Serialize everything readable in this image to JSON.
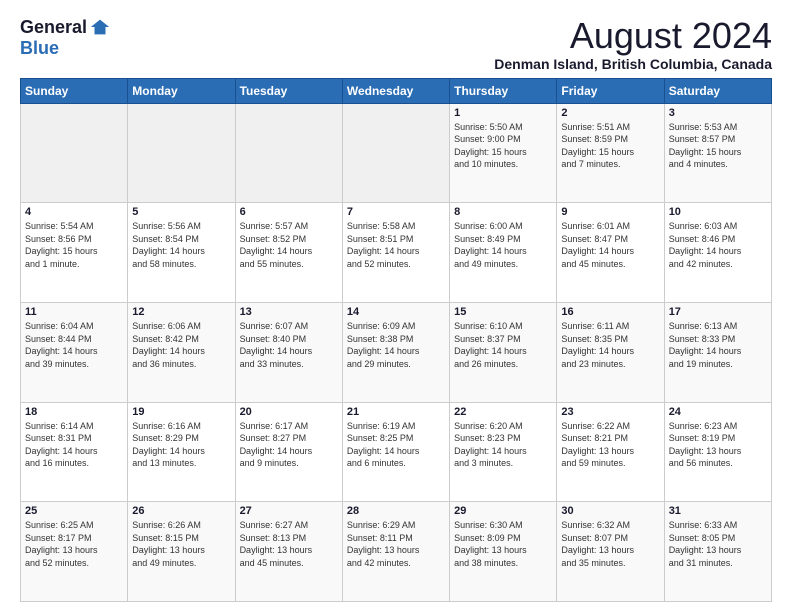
{
  "logo": {
    "general": "General",
    "blue": "Blue"
  },
  "title": "August 2024",
  "subtitle": "Denman Island, British Columbia, Canada",
  "days_of_week": [
    "Sunday",
    "Monday",
    "Tuesday",
    "Wednesday",
    "Thursday",
    "Friday",
    "Saturday"
  ],
  "weeks": [
    [
      {
        "day": "",
        "info": ""
      },
      {
        "day": "",
        "info": ""
      },
      {
        "day": "",
        "info": ""
      },
      {
        "day": "",
        "info": ""
      },
      {
        "day": "1",
        "info": "Sunrise: 5:50 AM\nSunset: 9:00 PM\nDaylight: 15 hours\nand 10 minutes."
      },
      {
        "day": "2",
        "info": "Sunrise: 5:51 AM\nSunset: 8:59 PM\nDaylight: 15 hours\nand 7 minutes."
      },
      {
        "day": "3",
        "info": "Sunrise: 5:53 AM\nSunset: 8:57 PM\nDaylight: 15 hours\nand 4 minutes."
      }
    ],
    [
      {
        "day": "4",
        "info": "Sunrise: 5:54 AM\nSunset: 8:56 PM\nDaylight: 15 hours\nand 1 minute."
      },
      {
        "day": "5",
        "info": "Sunrise: 5:56 AM\nSunset: 8:54 PM\nDaylight: 14 hours\nand 58 minutes."
      },
      {
        "day": "6",
        "info": "Sunrise: 5:57 AM\nSunset: 8:52 PM\nDaylight: 14 hours\nand 55 minutes."
      },
      {
        "day": "7",
        "info": "Sunrise: 5:58 AM\nSunset: 8:51 PM\nDaylight: 14 hours\nand 52 minutes."
      },
      {
        "day": "8",
        "info": "Sunrise: 6:00 AM\nSunset: 8:49 PM\nDaylight: 14 hours\nand 49 minutes."
      },
      {
        "day": "9",
        "info": "Sunrise: 6:01 AM\nSunset: 8:47 PM\nDaylight: 14 hours\nand 45 minutes."
      },
      {
        "day": "10",
        "info": "Sunrise: 6:03 AM\nSunset: 8:46 PM\nDaylight: 14 hours\nand 42 minutes."
      }
    ],
    [
      {
        "day": "11",
        "info": "Sunrise: 6:04 AM\nSunset: 8:44 PM\nDaylight: 14 hours\nand 39 minutes."
      },
      {
        "day": "12",
        "info": "Sunrise: 6:06 AM\nSunset: 8:42 PM\nDaylight: 14 hours\nand 36 minutes."
      },
      {
        "day": "13",
        "info": "Sunrise: 6:07 AM\nSunset: 8:40 PM\nDaylight: 14 hours\nand 33 minutes."
      },
      {
        "day": "14",
        "info": "Sunrise: 6:09 AM\nSunset: 8:38 PM\nDaylight: 14 hours\nand 29 minutes."
      },
      {
        "day": "15",
        "info": "Sunrise: 6:10 AM\nSunset: 8:37 PM\nDaylight: 14 hours\nand 26 minutes."
      },
      {
        "day": "16",
        "info": "Sunrise: 6:11 AM\nSunset: 8:35 PM\nDaylight: 14 hours\nand 23 minutes."
      },
      {
        "day": "17",
        "info": "Sunrise: 6:13 AM\nSunset: 8:33 PM\nDaylight: 14 hours\nand 19 minutes."
      }
    ],
    [
      {
        "day": "18",
        "info": "Sunrise: 6:14 AM\nSunset: 8:31 PM\nDaylight: 14 hours\nand 16 minutes."
      },
      {
        "day": "19",
        "info": "Sunrise: 6:16 AM\nSunset: 8:29 PM\nDaylight: 14 hours\nand 13 minutes."
      },
      {
        "day": "20",
        "info": "Sunrise: 6:17 AM\nSunset: 8:27 PM\nDaylight: 14 hours\nand 9 minutes."
      },
      {
        "day": "21",
        "info": "Sunrise: 6:19 AM\nSunset: 8:25 PM\nDaylight: 14 hours\nand 6 minutes."
      },
      {
        "day": "22",
        "info": "Sunrise: 6:20 AM\nSunset: 8:23 PM\nDaylight: 14 hours\nand 3 minutes."
      },
      {
        "day": "23",
        "info": "Sunrise: 6:22 AM\nSunset: 8:21 PM\nDaylight: 13 hours\nand 59 minutes."
      },
      {
        "day": "24",
        "info": "Sunrise: 6:23 AM\nSunset: 8:19 PM\nDaylight: 13 hours\nand 56 minutes."
      }
    ],
    [
      {
        "day": "25",
        "info": "Sunrise: 6:25 AM\nSunset: 8:17 PM\nDaylight: 13 hours\nand 52 minutes."
      },
      {
        "day": "26",
        "info": "Sunrise: 6:26 AM\nSunset: 8:15 PM\nDaylight: 13 hours\nand 49 minutes."
      },
      {
        "day": "27",
        "info": "Sunrise: 6:27 AM\nSunset: 8:13 PM\nDaylight: 13 hours\nand 45 minutes."
      },
      {
        "day": "28",
        "info": "Sunrise: 6:29 AM\nSunset: 8:11 PM\nDaylight: 13 hours\nand 42 minutes."
      },
      {
        "day": "29",
        "info": "Sunrise: 6:30 AM\nSunset: 8:09 PM\nDaylight: 13 hours\nand 38 minutes."
      },
      {
        "day": "30",
        "info": "Sunrise: 6:32 AM\nSunset: 8:07 PM\nDaylight: 13 hours\nand 35 minutes."
      },
      {
        "day": "31",
        "info": "Sunrise: 6:33 AM\nSunset: 8:05 PM\nDaylight: 13 hours\nand 31 minutes."
      }
    ]
  ]
}
